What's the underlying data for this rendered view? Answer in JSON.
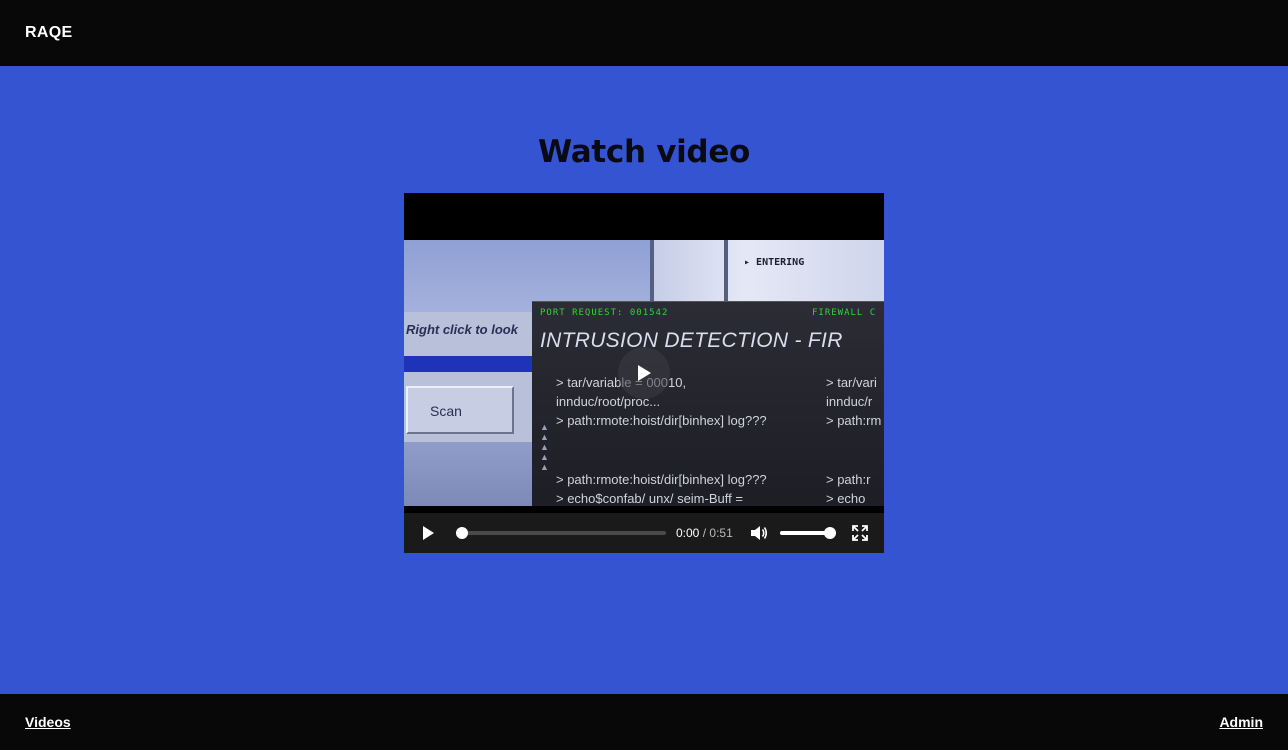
{
  "header": {
    "brand": "RAQE"
  },
  "main": {
    "title": "Watch video",
    "video": {
      "frame": {
        "entering": "ENTERING",
        "right_click": "Right click to look",
        "scan_label": "Scan",
        "port_request": "PORT REQUEST: 001542",
        "firewall": "FIREWALL C",
        "headline": "INTRUSION DETECTION - FIR",
        "lines": [
          "> tar/variable = 00010,",
          "innduc/root/proc...",
          "> path:rmote:hoist/dir[binhex]   log???",
          "> path:rmote:hoist/dir[binhex]   log???",
          "> echo$confab/ unx/ seim-Buff ="
        ],
        "right_lines": [
          "> tar/vari",
          "innduc/r",
          "> path:rm",
          "> path:r",
          "> echo"
        ]
      },
      "controls": {
        "current_time": "0:00",
        "separator": "/",
        "duration": "0:51",
        "progress": 0,
        "volume": 1.0
      }
    }
  },
  "footer": {
    "videos_link": "Videos",
    "admin_link": "Admin"
  }
}
